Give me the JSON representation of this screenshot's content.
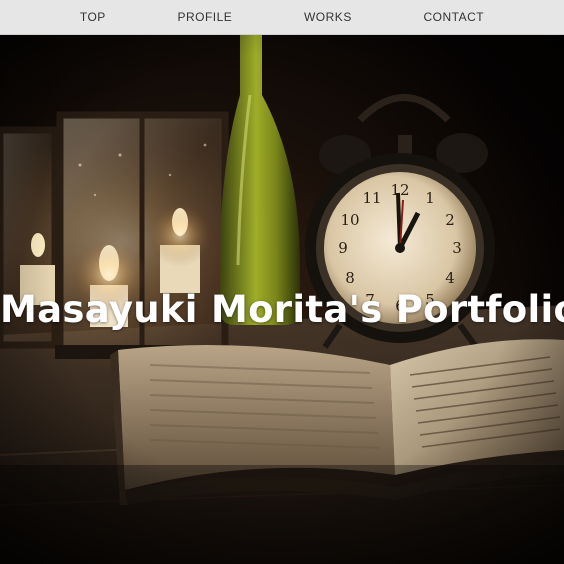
{
  "nav": {
    "items": [
      {
        "label": "TOP"
      },
      {
        "label": "PROFILE"
      },
      {
        "label": "WORKS"
      },
      {
        "label": "CONTACT"
      }
    ]
  },
  "hero": {
    "title": "Masayuki Morita's Portfolio",
    "image": "hero-photo-clock-lantern-book",
    "clock_numerals": [
      "12",
      "1",
      "2",
      "3",
      "4",
      "5",
      "6",
      "7",
      "8",
      "9",
      "10",
      "11"
    ]
  },
  "colors": {
    "nav_background": "#e6e6e6",
    "nav_text": "#333333",
    "title_text": "#ffffff",
    "photo_dark": "#0b0806",
    "candle_glow": "#f3d9a8",
    "bottle_green": "#8a9a1e"
  }
}
